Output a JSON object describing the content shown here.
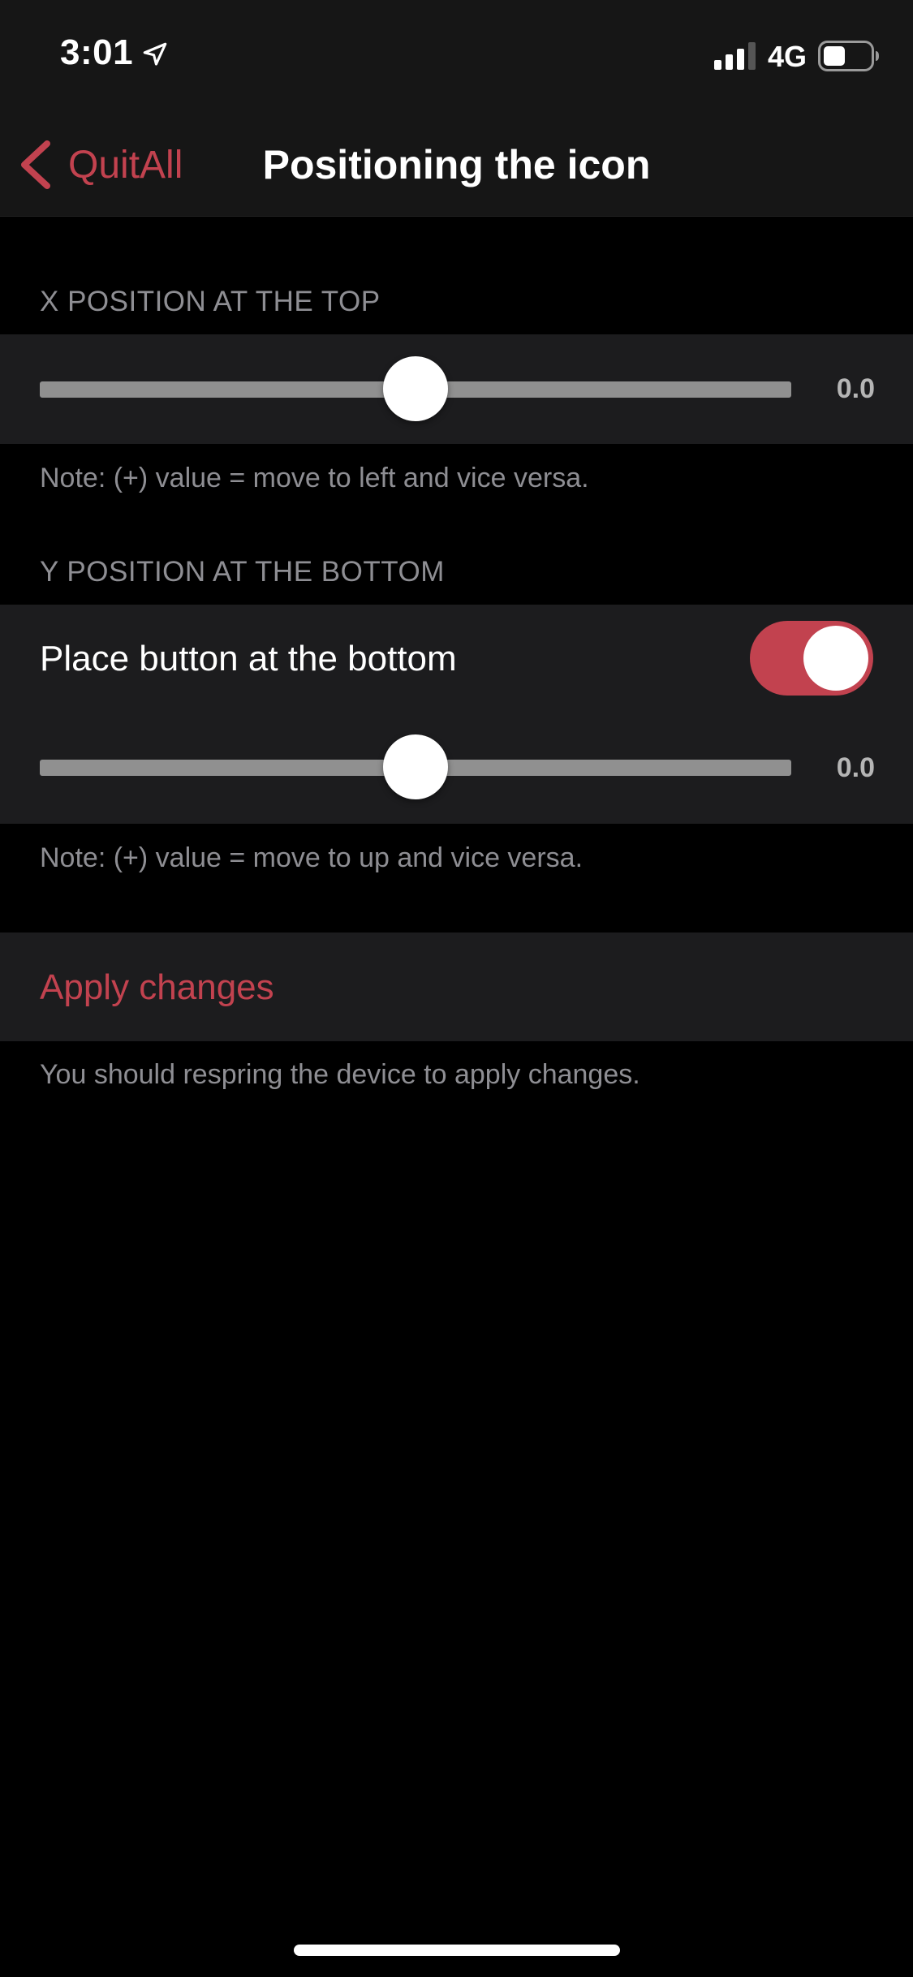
{
  "status_bar": {
    "time": "3:01",
    "network": "4G",
    "icons": [
      "location-arrow-icon",
      "signal-bars-icon",
      "battery-icon"
    ]
  },
  "nav": {
    "back_label": "QuitAll",
    "title": "Positioning the icon"
  },
  "x_section": {
    "header": "X POSITION AT THE TOP",
    "slider_value": "0.0",
    "slider_fraction": 0.5,
    "note": "Note: (+) value = move to left and vice versa."
  },
  "y_section": {
    "header": "Y POSITION AT THE BOTTOM",
    "toggle_label": "Place button at the bottom",
    "toggle_on": true,
    "slider_value": "0.0",
    "slider_fraction": 0.5,
    "note": "Note: (+) value = move to up and vice versa."
  },
  "apply_section": {
    "label": "Apply changes",
    "note": "You should respring the device to apply changes."
  },
  "colors": {
    "accent": "#c2424f",
    "background": "#000000",
    "cell": "#1c1c1e",
    "secondary_text": "#8e8e93"
  }
}
